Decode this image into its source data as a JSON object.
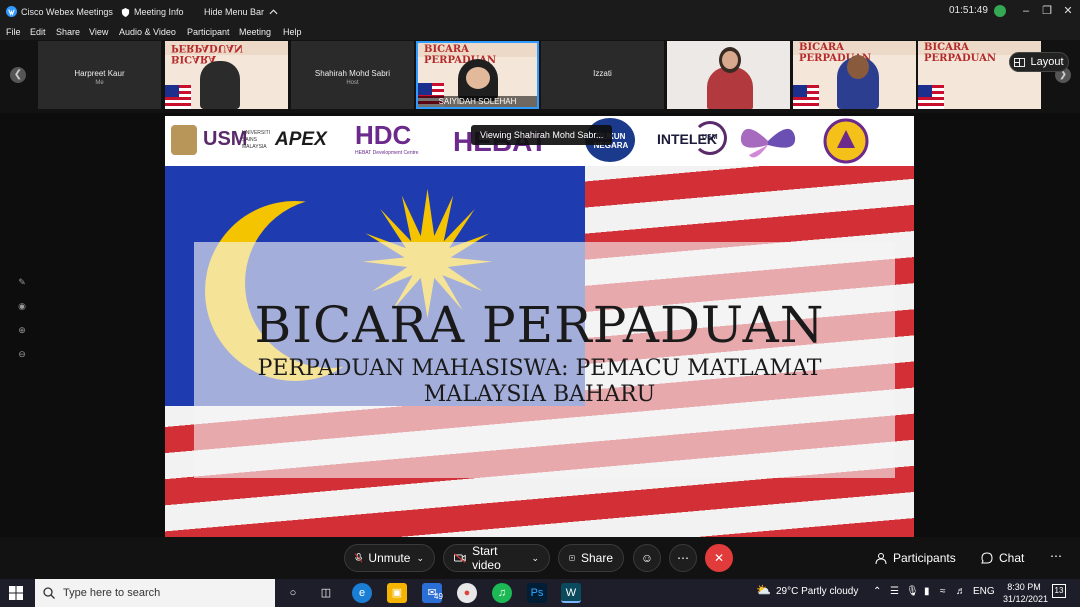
{
  "titlebar": {
    "app_name": "Cisco Webex Meetings",
    "meeting_info": "Meeting Info",
    "hide_menu": "Hide Menu Bar",
    "elapsed": "01:51:49"
  },
  "menu": [
    "File",
    "Edit",
    "Share",
    "View",
    "Audio & Video",
    "Participant",
    "Meeting",
    "Help"
  ],
  "participants_strip": {
    "tiles": [
      {
        "name": "Harpreet Kaur",
        "role": "Me"
      },
      {
        "name": "Shahirah Mohd Sabri",
        "role": "Host"
      },
      {
        "name": "SAIYIDAH SOLEHAH",
        "role": ""
      },
      {
        "name": "Izzati",
        "role": ""
      }
    ],
    "poster_title": "BICARA PERPADUAN",
    "poster_title_flipped": "BICARA PERPADUAN",
    "layout_label": "Layout"
  },
  "slide": {
    "viewing_label": "Viewing Shahirah Mohd Sabr...",
    "logos": {
      "usm": "USM",
      "usm_sub": "UNIVERSITI SAINS MALAYSIA",
      "apex": "APEX",
      "hdc": "HDC",
      "hdc_sub": "HEBAT Development Centre",
      "hebat": "HEBAT",
      "rukun": "RUKUN NEGARA",
      "intelek": "INTELEK",
      "intelek_usm": "USM"
    },
    "title": "BICARA PERPADUAN",
    "subtitle_line1": "PERPADUAN MAHASISWA: PEMACU MATLAMAT",
    "subtitle_line2": "MALAYSIA BAHARU"
  },
  "controls": {
    "unmute": "Unmute",
    "start_video": "Start video",
    "share": "Share",
    "participants": "Participants",
    "chat": "Chat"
  },
  "taskbar": {
    "search_placeholder": "Type here to search",
    "mail_badge": "49",
    "weather": "29°C  Partly cloudy",
    "lang": "ENG",
    "time": "8:30 PM",
    "date": "31/12/2021",
    "notif_count": "13"
  },
  "colors": {
    "accent": "#2f9bff",
    "end_call": "#e23b3b",
    "flag_red": "#d32f36",
    "flag_blue": "#1f3bb0",
    "flag_yellow": "#f5c400"
  }
}
